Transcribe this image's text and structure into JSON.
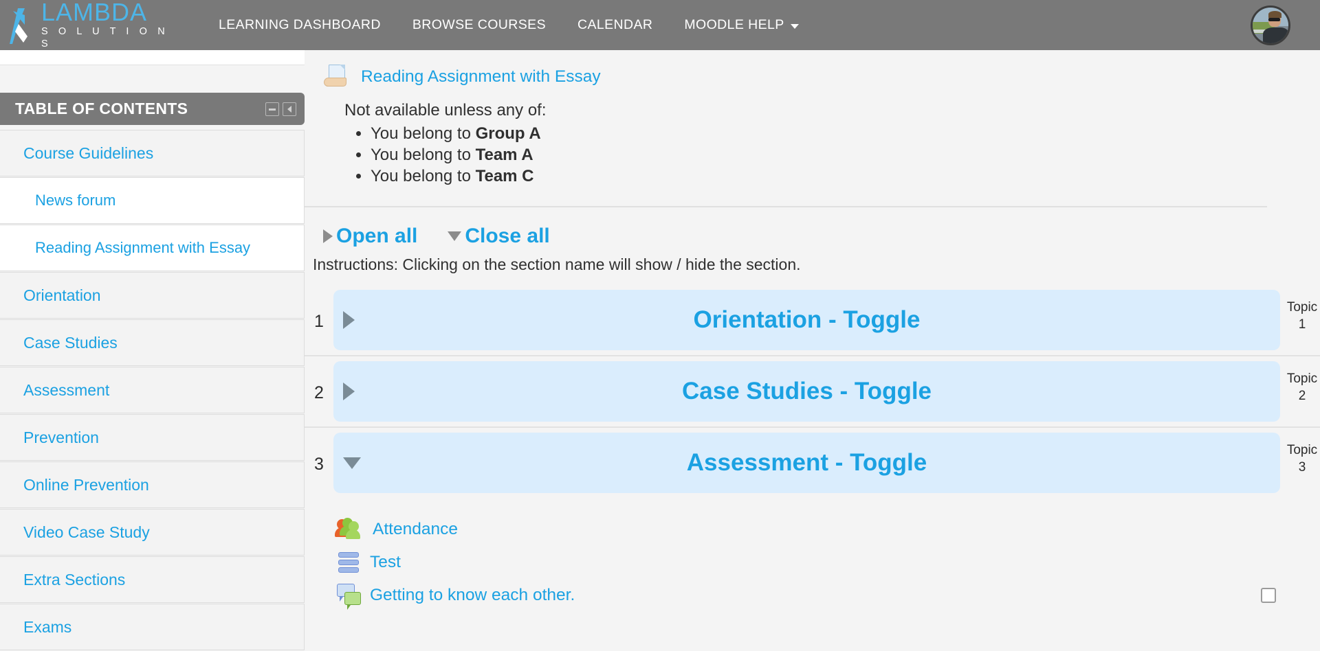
{
  "brand": {
    "name": "LAMBDA",
    "subtitle": "S O L U T I O N S",
    "logo_icon": "lambda-arrow-logo"
  },
  "topnav": {
    "links": [
      {
        "label": "LEARNING DASHBOARD",
        "has_caret": false
      },
      {
        "label": "BROWSE COURSES",
        "has_caret": false
      },
      {
        "label": "CALENDAR",
        "has_caret": false
      },
      {
        "label": "MOODLE HELP",
        "has_caret": true
      }
    ],
    "avatar_alt": "user-avatar"
  },
  "sidebar": {
    "title": "TABLE OF CONTENTS",
    "actions": [
      {
        "icon": "minimize-icon"
      },
      {
        "icon": "collapse-left-icon"
      }
    ],
    "items": [
      {
        "label": "Course Guidelines",
        "level": 1
      },
      {
        "label": "News forum",
        "level": 2
      },
      {
        "label": "Reading Assignment with Essay",
        "level": 2
      },
      {
        "label": "Orientation",
        "level": 1
      },
      {
        "label": "Case Studies",
        "level": 1
      },
      {
        "label": "Assessment",
        "level": 1
      },
      {
        "label": "Prevention",
        "level": 1
      },
      {
        "label": "Online Prevention",
        "level": 1
      },
      {
        "label": "Video Case Study",
        "level": 1
      },
      {
        "label": "Extra Sections",
        "level": 1
      },
      {
        "label": "Exams",
        "level": 1
      }
    ]
  },
  "main": {
    "assignment": {
      "name": "Reading Assignment with Essay",
      "icon": "assignment-icon",
      "restriction_heading": "Not available unless any of:",
      "restriction_items": [
        {
          "prefix": "You belong to ",
          "strong": "Group A"
        },
        {
          "prefix": "You belong to ",
          "strong": "Team A"
        },
        {
          "prefix": "You belong to ",
          "strong": "Team C"
        }
      ]
    },
    "toggle_controls": {
      "open_all": "Open all",
      "close_all": "Close all",
      "open_icon": "triangle-right-icon",
      "close_icon": "triangle-down-icon",
      "instructions": "Instructions: Clicking on the section name will show / hide the section."
    },
    "sections": [
      {
        "number": "1",
        "title": "Orientation - Toggle",
        "state": "collapsed",
        "topic_label": "Topic",
        "topic_number": "1"
      },
      {
        "number": "2",
        "title": "Case Studies - Toggle",
        "state": "collapsed",
        "topic_label": "Topic",
        "topic_number": "2"
      },
      {
        "number": "3",
        "title": "Assessment - Toggle",
        "state": "expanded",
        "topic_label": "Topic",
        "topic_number": "3"
      }
    ],
    "activities": [
      {
        "name": "Attendance",
        "icon": "attendance-people-icon",
        "has_completion_box": false
      },
      {
        "name": "Test",
        "icon": "quiz-icon",
        "has_completion_box": false
      },
      {
        "name": "Getting to know each other.",
        "icon": "forum-icon",
        "has_completion_box": true
      }
    ]
  },
  "colors": {
    "nav_background": "#797979",
    "brand_blue": "#4db5e8",
    "link_blue": "#1ba1e2",
    "section_blue": "#daedfd",
    "page_background": "#f4f4f4"
  }
}
